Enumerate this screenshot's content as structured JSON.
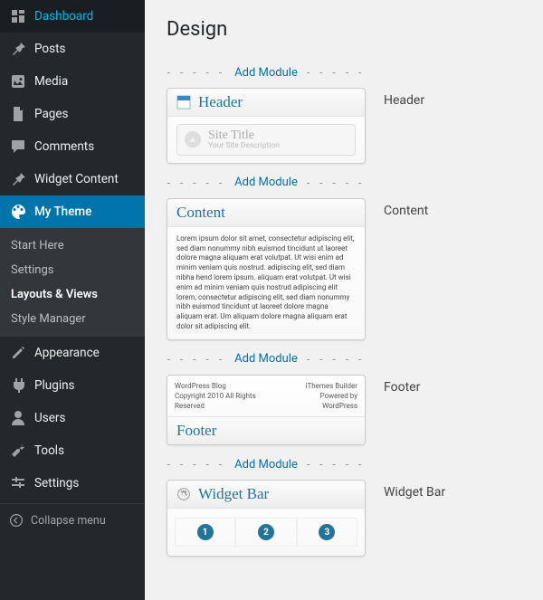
{
  "sidebar": {
    "dashboard": "Dashboard",
    "posts": "Posts",
    "media": "Media",
    "pages": "Pages",
    "comments": "Comments",
    "widget_content": "Widget Content",
    "my_theme": "My Theme",
    "submenu": {
      "start": "Start Here",
      "settings": "Settings",
      "layouts": "Layouts & Views",
      "style": "Style Manager"
    },
    "appearance": "Appearance",
    "plugins": "Plugins",
    "users": "Users",
    "tools": "Tools",
    "settings_nav": "Settings",
    "collapse": "Collapse menu"
  },
  "page": {
    "title": "Design"
  },
  "add_module": "Add Module",
  "sections": {
    "header": {
      "label": "Header",
      "module_title": "Header",
      "site_title": "Site Title",
      "site_desc": "Your Site Description"
    },
    "content": {
      "label": "Content",
      "module_title": "Content",
      "lorem": "Lorem ipsum dolor sit amet, consectetur adipiscing elit, sed diam nonummy nibh euismod tincidunt ut laoreet dolore magna aliquam erat volutpat. Ut wisi enim ad minim veniam quis nostrud. adipiscing elit, sed diam nibha hend lorem ipsum. aliquam erat volutpat. Ut wisi enim ad minim veniam quis nostrud adipiscing elit lorem, consectetur adipiscing elit, sed diam nonummy nibh euismod tincidunt ut laoreet dolore magna aliquam erat. Um aliquam dolore magna aliquam erat dolor sit adipiscing elit."
    },
    "footer": {
      "label": "Footer",
      "module_title": "Footer",
      "left1": "WordPress Blog",
      "left2": "Copyright 2010 All Rights Reserved",
      "right1": "iThemes Builder",
      "right2": "Powered by WordPress"
    },
    "widget": {
      "label": "Widget Bar",
      "module_title": "Widget Bar",
      "nums": [
        "1",
        "2",
        "3"
      ]
    }
  }
}
